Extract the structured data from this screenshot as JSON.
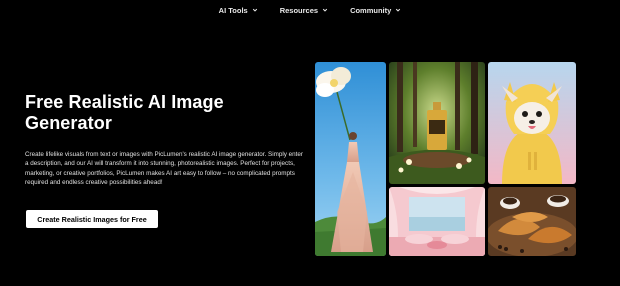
{
  "nav": {
    "items": [
      {
        "label": "AI Tools",
        "icon": "chevron-down-icon"
      },
      {
        "label": "Resources",
        "icon": "chevron-down-icon"
      },
      {
        "label": "Community",
        "icon": "chevron-down-icon"
      }
    ]
  },
  "hero": {
    "title": "Free Realistic AI Image Generator",
    "description": "Create lifelike visuals from text or images with PicLumen's realistic AI image generator. Simply enter a description, and our AI will transform it into stunning, photorealistic images. Perfect for projects, marketing, or creative portfolios, PicLumen makes AI art easy to follow – no complicated prompts required and endless creative possibilities ahead!",
    "cta_label": "Create Realistic Images for Free"
  },
  "gallery": {
    "images": [
      {
        "subject": "woman-with-giant-flower"
      },
      {
        "subject": "perfume-bottle-in-forest"
      },
      {
        "subject": "chihuahua-in-yellow-hoodie"
      },
      {
        "subject": "pink-lounge-interior"
      },
      {
        "subject": "croissants-and-coffee"
      }
    ]
  }
}
